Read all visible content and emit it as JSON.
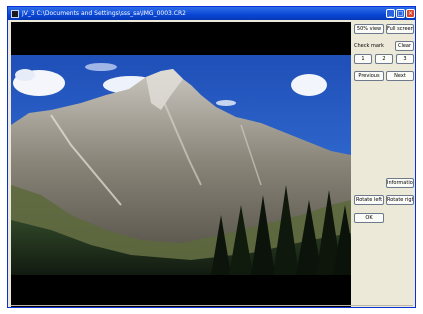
{
  "window": {
    "title": "JV_3 C:\\Documents and Settings\\sss_sa\\IMG_0003.CR2"
  },
  "title_buttons": {
    "minimize": "_",
    "maximize": "□",
    "close": "×"
  },
  "panel": {
    "fit_view_label": "50% view",
    "full_screen_label": "Full screen",
    "check_mark_label": "Check mark",
    "clear_label": "Clear",
    "mark1": "1",
    "mark2": "2",
    "mark3": "3",
    "previous_label": "Previous",
    "next_label": "Next",
    "information_label": "Information",
    "rotate_left_label": "Rotate left",
    "rotate_right_label": "Rotate right",
    "ok_label": "OK"
  },
  "image": {
    "subject": "mountain landscape photo"
  },
  "colors": {
    "titlebar": "#0a46d4",
    "window_bg": "#ece9d8",
    "viewer_bg": "#000000",
    "close_button": "#d9472b"
  }
}
